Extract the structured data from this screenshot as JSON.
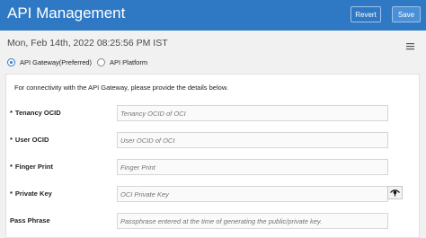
{
  "header": {
    "title": "API Management",
    "revert_label": "Revert",
    "save_label": "Save"
  },
  "datetime": "Mon, Feb 14th, 2022 08:25:56 PM IST",
  "radio_options": [
    {
      "label": "API Gateway(Preferred)",
      "selected": true
    },
    {
      "label": "API Platform",
      "selected": false
    }
  ],
  "form": {
    "intro": "For connectivity with the API Gateway, please provide the details below.",
    "fields": [
      {
        "label": "Tenancy OCID",
        "required": true,
        "placeholder": "Tenancy OCID of OCI"
      },
      {
        "label": "User OCID",
        "required": true,
        "placeholder": "User OCID of OCI"
      },
      {
        "label": "Finger Print",
        "required": true,
        "placeholder": "Finger Print"
      },
      {
        "label": "Private Key",
        "required": true,
        "placeholder": "OCI Private Key"
      },
      {
        "label": "Pass Phrase",
        "required": false,
        "placeholder": "Passphrase entered at the time of generating the public/private key."
      }
    ],
    "required_marker": "*"
  },
  "colors": {
    "header_bg": "#2f79c4",
    "page_bg": "#f1f1f1"
  },
  "icons": [
    "hamburger-menu-icon",
    "eye-icon"
  ]
}
